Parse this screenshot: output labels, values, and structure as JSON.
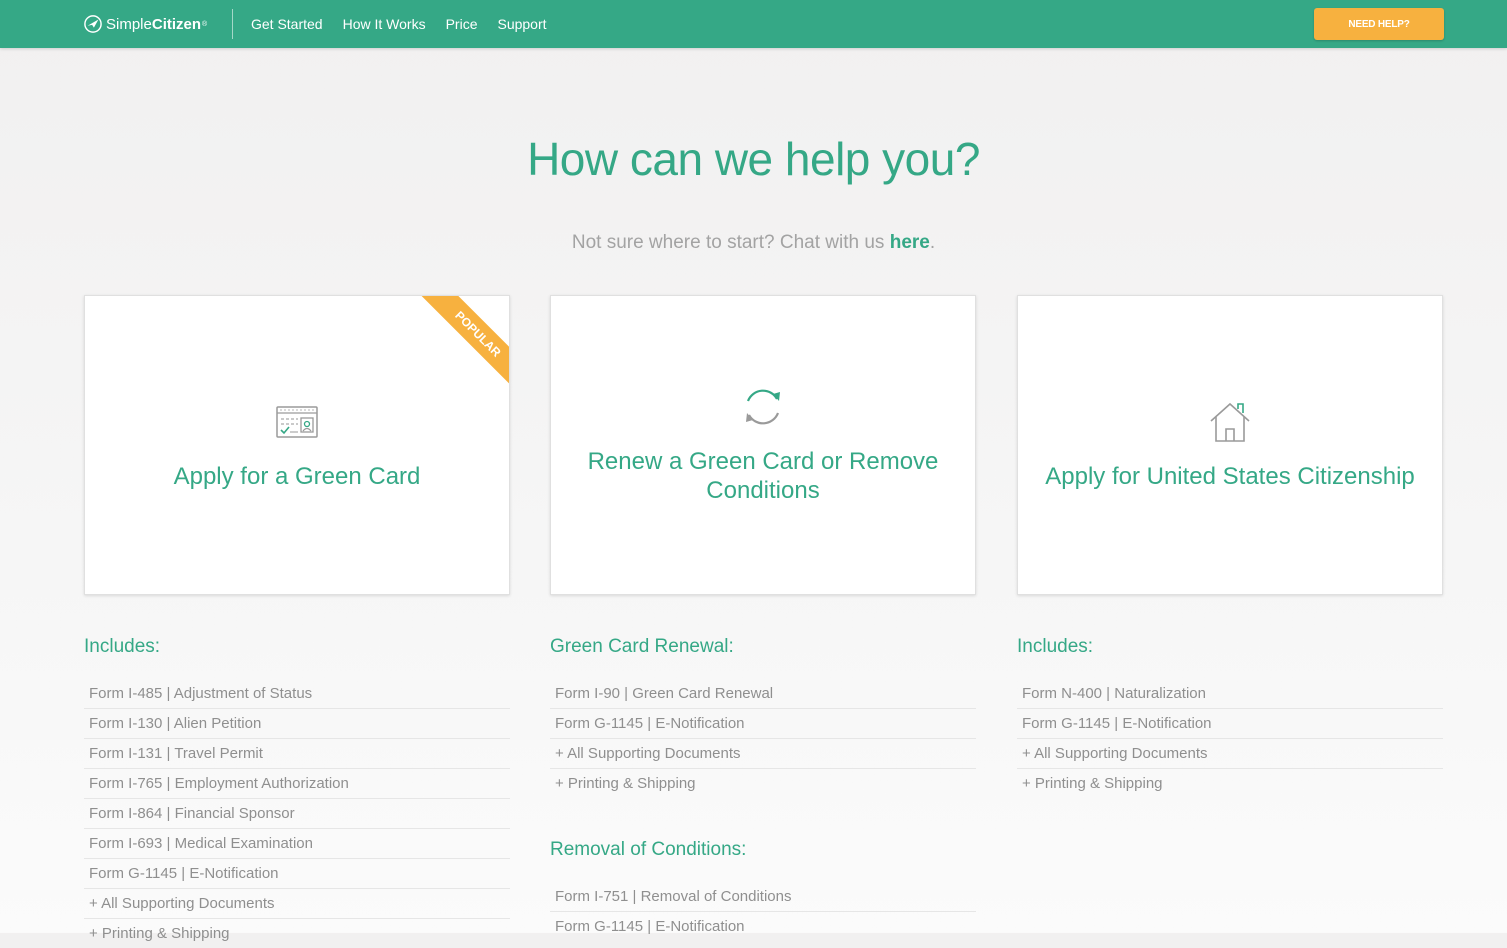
{
  "brand": {
    "name_light": "Simple",
    "name_bold": "Citizen",
    "trademark": "®",
    "color": "#35a886",
    "accent": "#f7b13f"
  },
  "nav": {
    "items": [
      "Get Started",
      "How It Works",
      "Price",
      "Support"
    ],
    "help_button": "NEED HELP?"
  },
  "hero": {
    "title": "How can we help you?",
    "subtitle_prefix": "Not sure where to start? Chat with us ",
    "subtitle_link": "here",
    "subtitle_suffix": "."
  },
  "cards": [
    {
      "title": "Apply for a Green Card",
      "icon": "id-card-icon",
      "badge": "POPULAR"
    },
    {
      "title": "Renew a Green Card or Remove Conditions",
      "icon": "refresh-icon"
    },
    {
      "title": "Apply for United States Citizenship",
      "icon": "house-icon"
    }
  ],
  "columns": {
    "green_card": {
      "heading": "Includes:",
      "items": [
        "Form I-485 | Adjustment of Status",
        "Form I-130 | Alien Petition",
        "Form I-131 | Travel Permit",
        "Form I-765 | Employment Authorization",
        "Form I-864 | Financial Sponsor",
        "Form I-693 | Medical Examination",
        "Form G-1145 | E-Notification",
        "+ All Supporting Documents",
        "+ Printing & Shipping"
      ]
    },
    "renewal": {
      "heading": "Green Card Renewal:",
      "items": [
        "Form I-90 | Green Card Renewal",
        "Form G-1145 | E-Notification",
        "+ All Supporting Documents",
        "+ Printing & Shipping"
      ]
    },
    "removal": {
      "heading": "Removal of Conditions:",
      "items": [
        "Form I-751 | Removal of Conditions",
        "Form G-1145 | E-Notification"
      ]
    },
    "citizenship": {
      "heading": "Includes:",
      "items": [
        "Form N-400 | Naturalization",
        "Form G-1145 | E-Notification",
        "+ All Supporting Documents",
        "+ Printing & Shipping"
      ]
    }
  }
}
